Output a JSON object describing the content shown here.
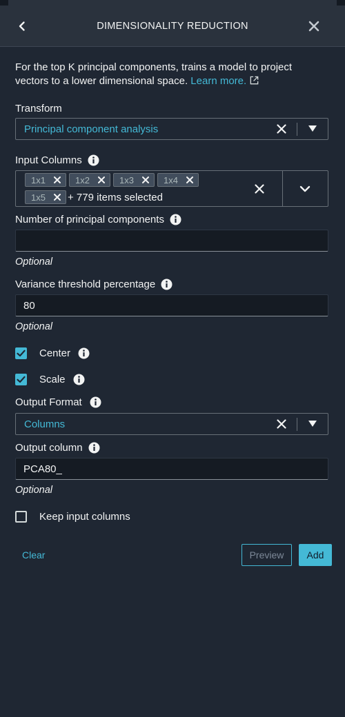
{
  "header": {
    "title": "DIMENSIONALITY REDUCTION",
    "back_icon": "chevron-left-icon",
    "close_icon": "close-icon"
  },
  "description": {
    "text": "For the top K principal components, trains a model to project vectors to a lower dimensional space.",
    "link": "Learn more.",
    "link_icon": "external-link-icon"
  },
  "transform": {
    "label": "Transform",
    "value": "Principal component analysis"
  },
  "input_columns": {
    "label": "Input Columns",
    "tokens": [
      "1x1",
      "1x2",
      "1x3",
      "1x4",
      "1x5"
    ],
    "count_text": "+ 779 items selected"
  },
  "num_components": {
    "label": "Number of principal components",
    "value": "",
    "hint": "Optional"
  },
  "variance_threshold": {
    "label": "Variance threshold percentage",
    "value": "80",
    "hint": "Optional"
  },
  "center": {
    "label": "Center",
    "checked": true
  },
  "scale": {
    "label": "Scale",
    "checked": true
  },
  "output_format": {
    "label": "Output Format",
    "value": "Columns"
  },
  "output_column": {
    "label": "Output column",
    "value": "PCA80_",
    "hint": "Optional"
  },
  "keep_input": {
    "label": "Keep input columns",
    "checked": false
  },
  "footer": {
    "clear_label": "Clear",
    "preview_label": "Preview",
    "add_label": "Add"
  },
  "colors": {
    "background": "#1f2733",
    "header": "#2a323d",
    "accent": "#44b9d6",
    "text": "#f2f3f3",
    "border": "#687078"
  }
}
